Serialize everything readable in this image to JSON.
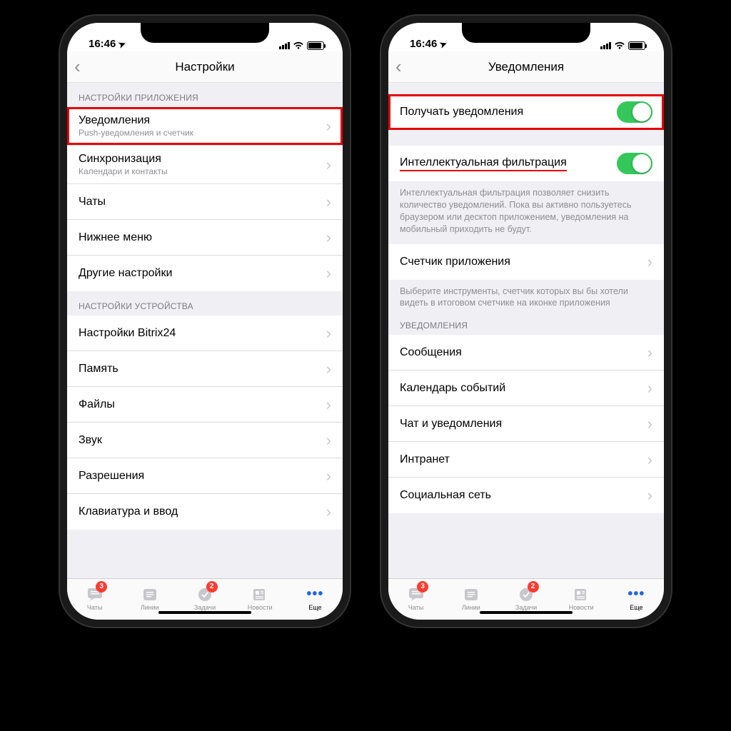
{
  "status": {
    "time": "16:46"
  },
  "left": {
    "title": "Настройки",
    "section1_header": "НАСТРОЙКИ ПРИЛОЖЕНИЯ",
    "rows_app": [
      {
        "title": "Уведомления",
        "sub": "Push-уведомления и счетчик",
        "highlight": true
      },
      {
        "title": "Синхронизация",
        "sub": "Календари и контакты"
      },
      {
        "title": "Чаты"
      },
      {
        "title": "Нижнее меню"
      },
      {
        "title": "Другие настройки"
      }
    ],
    "section2_header": "НАСТРОЙКИ УСТРОЙСТВА",
    "rows_device": [
      {
        "title": "Настройки Bitrix24"
      },
      {
        "title": "Память"
      },
      {
        "title": "Файлы"
      },
      {
        "title": "Звук"
      },
      {
        "title": "Разрешения"
      },
      {
        "title": "Клавиатура и ввод"
      }
    ]
  },
  "right": {
    "title": "Уведомления",
    "toggle1_label": "Получать уведомления",
    "toggle2_label": "Интеллектуальная фильтрация",
    "filter_desc": "Интеллектуальная фильтрация позволяет снизить количество уведомлений. Пока вы активно пользуетесь браузером или десктоп приложением, уведомления на мобильный приходить не будут.",
    "counter_label": "Счетчик приложения",
    "counter_desc": "Выберите инструменты, счетчик которых вы бы хотели видеть в итоговом счетчике на иконке приложения",
    "section_header": "УВЕДОМЛЕНИЯ",
    "rows": [
      {
        "title": "Сообщения"
      },
      {
        "title": "Календарь событий"
      },
      {
        "title": "Чат и уведомления"
      },
      {
        "title": "Интранет"
      },
      {
        "title": "Социальная сеть"
      }
    ]
  },
  "tabs": {
    "items": [
      {
        "label": "Чаты",
        "badge": "3"
      },
      {
        "label": "Линии"
      },
      {
        "label": "Задачи",
        "badge": "2"
      },
      {
        "label": "Новости"
      },
      {
        "label": "Еще",
        "active": true
      }
    ]
  }
}
